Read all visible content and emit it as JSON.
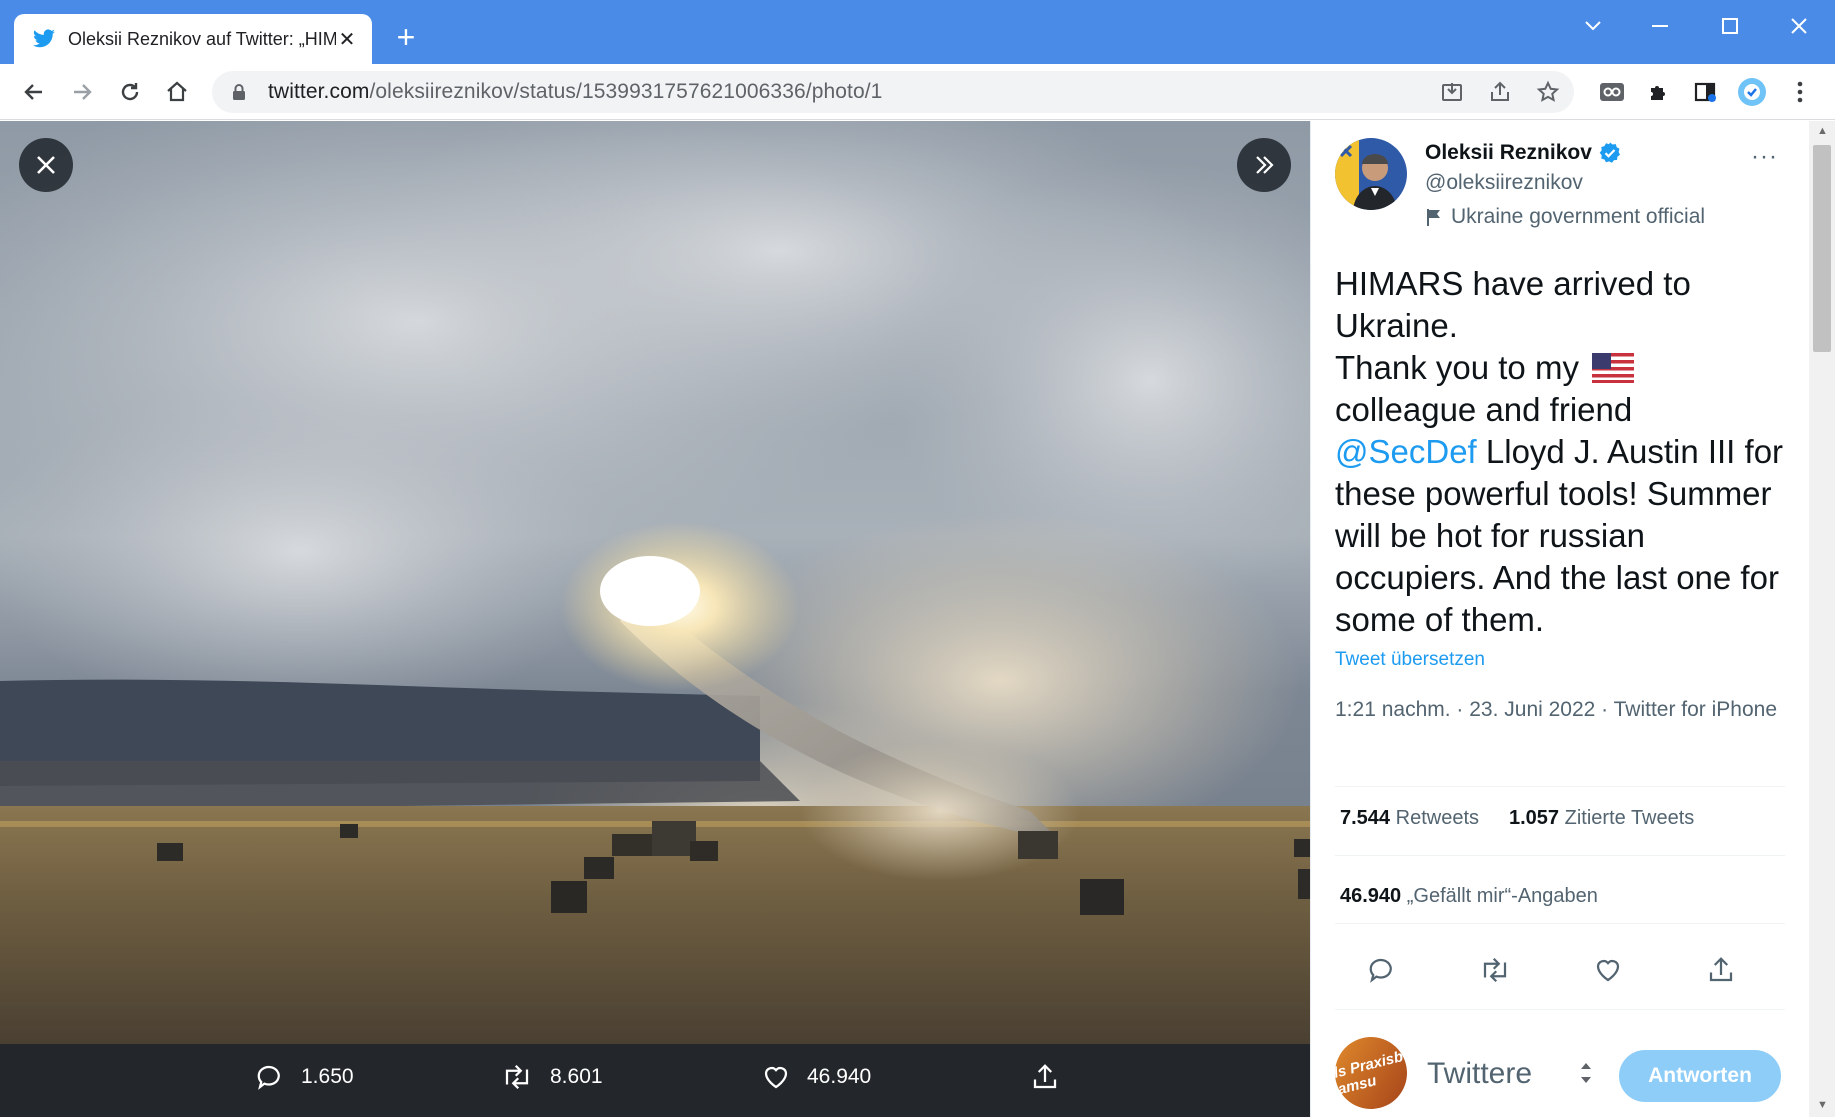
{
  "browser": {
    "tab_title": "Oleksii Reznikov auf Twitter: „HIMARS",
    "new_tab": "+",
    "url_host": "twitter.com",
    "url_path": "/oleksiireznikov/status/1539931757621006336/photo/1",
    "toolbar_icons": [
      "back-icon",
      "forward-icon",
      "reload-icon",
      "home-icon",
      "install-icon",
      "share-icon",
      "star-icon",
      "infinity-extension-icon",
      "puzzle-extension-icon",
      "sidebar-icon",
      "profile-icon",
      "menu-icon"
    ],
    "accent": "#4a8be8"
  },
  "photo": {
    "actions": {
      "replies": "1.650",
      "retweets": "8.601",
      "likes": "46.940"
    }
  },
  "tweet": {
    "author_name": "Oleksii Reznikov",
    "author_handle": "@oleksiireznikov",
    "label": "Ukraine government official",
    "more": "···",
    "text_part1": "HIMARS have arrived to Ukraine.",
    "text_part2": "Thank you to my",
    "text_part3": "colleague and friend",
    "mention": "@SecDef",
    "text_part4": " Lloyd J. Austin III for these powerful tools! Summer will be hot for russian occupiers. And the last one for some of them.",
    "translate": "Tweet übersetzen",
    "meta": "1:21 nachm. · 23. Juni 2022 · Twitter for iPhone",
    "retweets_count": "7.544",
    "retweets_label": "Retweets",
    "quotes_count": "1.057",
    "quotes_label": "Zitierte Tweets",
    "likes_count": "46.940",
    "likes_label": "„Gefällt mir“-Angaben",
    "link_color": "#1d9bf0"
  },
  "reply": {
    "avatar_text": "ls Praxisb amsu",
    "placeholder": "Twittere",
    "button": "Antworten"
  }
}
